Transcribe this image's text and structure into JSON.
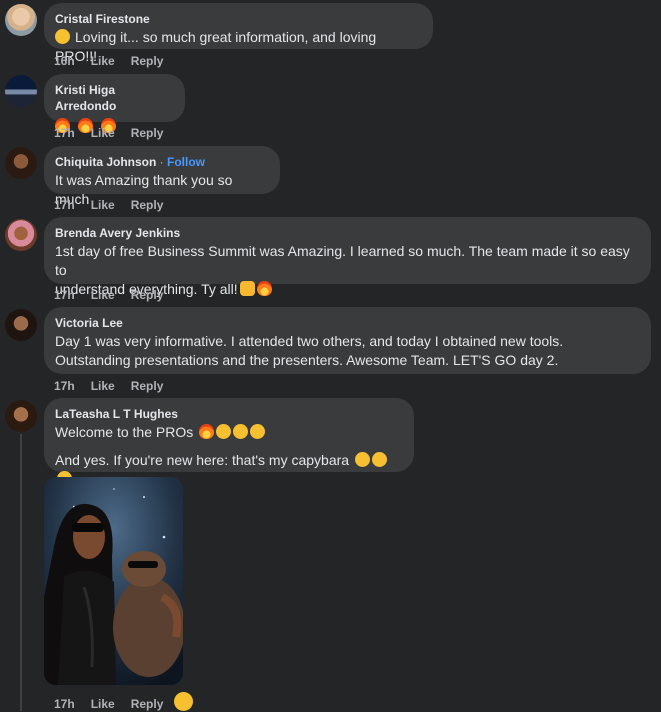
{
  "comments": [
    {
      "name": "Cristal Firestone",
      "text": "Loving it... so much great information, and loving PRO!!!",
      "time": "16h",
      "like": "Like",
      "reply": "Reply"
    },
    {
      "name": "Kristi Higa Arredondo",
      "text": "",
      "time": "17h",
      "like": "Like",
      "reply": "Reply"
    },
    {
      "name": "Chiquita Johnson",
      "follow": "Follow",
      "separator": "·",
      "text": "It was Amazing thank you so much",
      "time": "17h",
      "like": "Like",
      "reply": "Reply"
    },
    {
      "name": "Brenda Avery Jenkins",
      "text_line1": "1st day of free Business Summit was Amazing. I learned so much. The team made it so easy to",
      "text_line2": "understand everything. Ty all!",
      "time": "17h",
      "like": "Like",
      "reply": "Reply"
    },
    {
      "name": "Victoria Lee",
      "text_line1": "Day 1 was very informative. I attended two others, and today I obtained new tools.",
      "text_line2": "Outstanding presentations and the presenters. Awesome Team. LET'S GO day 2.",
      "time": "17h",
      "like": "Like",
      "reply": "Reply"
    },
    {
      "name": "LaTeasha L T Hughes",
      "text_line1": "Welcome to the PROs",
      "text_line2": "And yes. If you're new here: that's my capybara",
      "time": "17h",
      "like": "Like",
      "reply": "Reply"
    }
  ],
  "colors": {
    "background": "#242526",
    "bubble": "#3a3b3c",
    "name": "#e4e6eb",
    "meta": "#b0b3b8",
    "follow": "#4599ff"
  },
  "icons": [
    "smirk-emoji",
    "fire-emoji",
    "thumbs-up-emoji",
    "hug-emoji",
    "laugh-emoji",
    "grin-emoji"
  ]
}
